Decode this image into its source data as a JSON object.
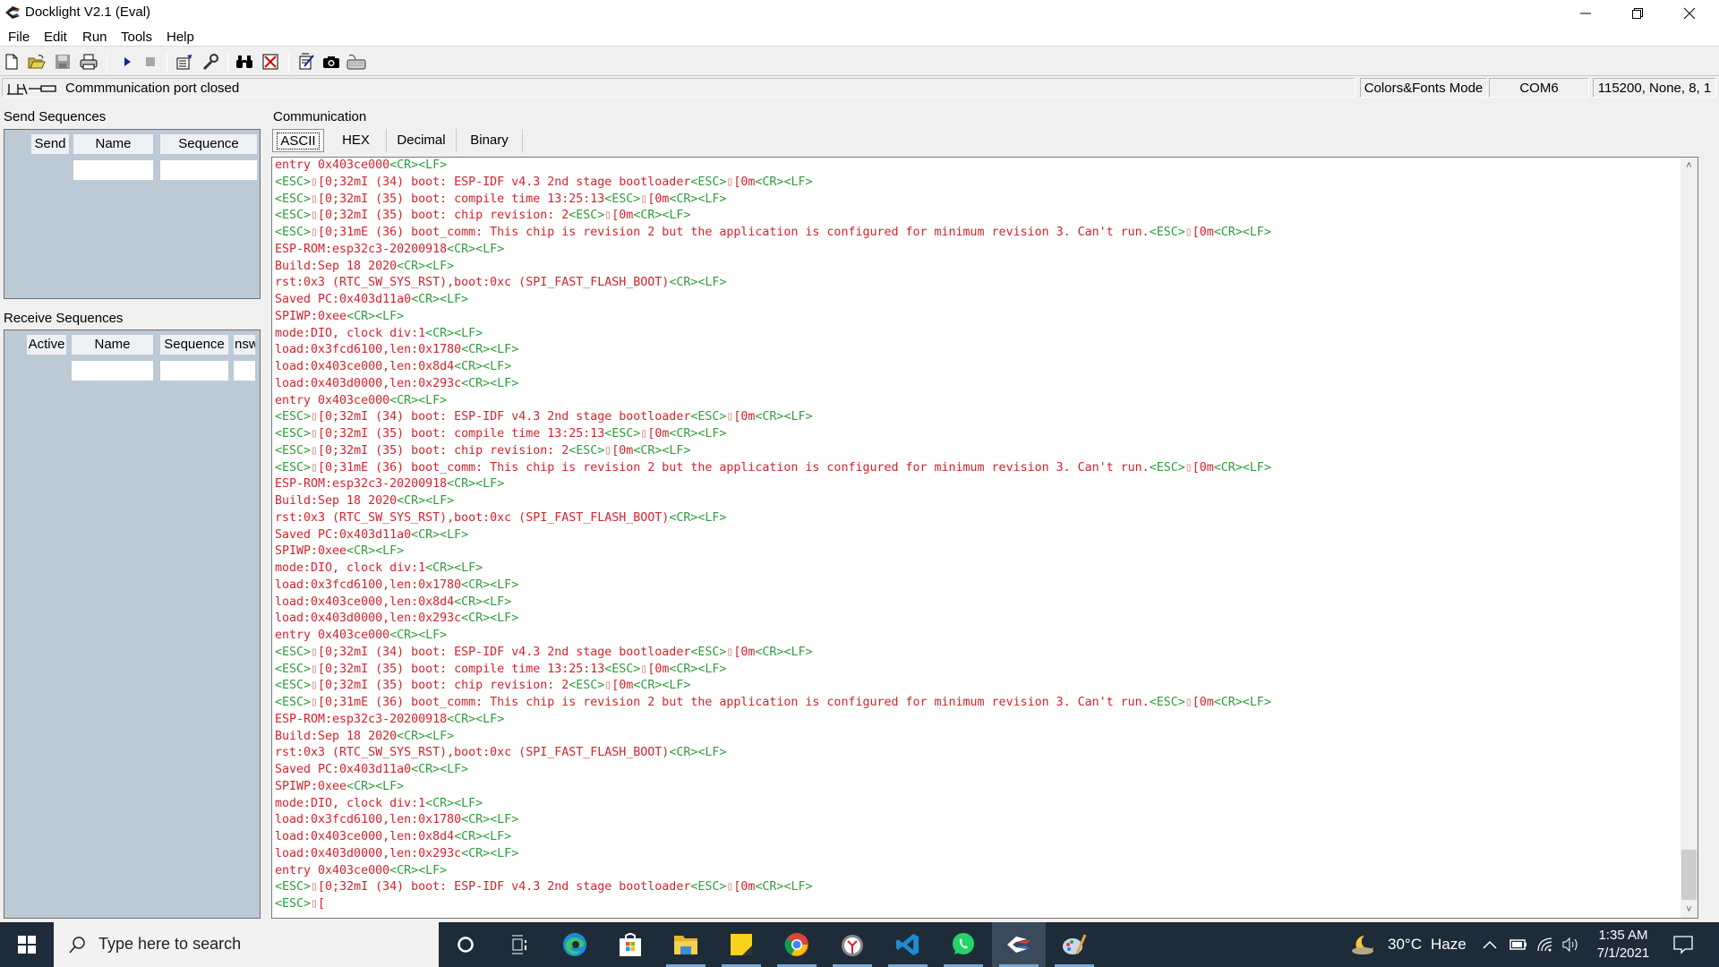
{
  "window": {
    "title": "Docklight V2.1 (Eval)",
    "controls": {
      "minimize": "—",
      "restore": "❐",
      "close": "✕"
    }
  },
  "menu": [
    "File",
    "Edit",
    "Run",
    "Tools",
    "Help"
  ],
  "toolbar": {
    "buttons": [
      "new-icon",
      "open-icon",
      "save-icon",
      "print-icon",
      "run-icon",
      "stop-icon",
      "project-settings-icon",
      "options-icon",
      "find-icon",
      "clear-icon",
      "edit-script-icon",
      "snapshot-icon",
      "keyboard-icon"
    ]
  },
  "status": {
    "message": "Commmunication port closed",
    "mode": "Colors&Fonts Mode",
    "port": "COM6",
    "settings": "115200, None, 8, 1"
  },
  "send_sequences": {
    "label": "Send Sequences",
    "columns": [
      "Send",
      "Name",
      "Sequence"
    ]
  },
  "receive_sequences": {
    "label": "Receive Sequences",
    "columns": [
      "Active",
      "Name",
      "Sequence",
      "nsw"
    ]
  },
  "communication": {
    "label": "Communication",
    "tabs": [
      "ASCII",
      "HEX",
      "Decimal",
      "Binary"
    ],
    "active_tab": "ASCII",
    "colors": {
      "data": "#d6222a",
      "control": "#2f9b3c"
    },
    "lines": [
      "entry 0x403ce000<CR><LF>",
      "<ESC>▯[0;32mI (34) boot: ESP-IDF v4.3 2nd stage bootloader<ESC>▯[0m<CR><LF>",
      "<ESC>▯[0;32mI (35) boot: compile time 13:25:13<ESC>▯[0m<CR><LF>",
      "<ESC>▯[0;32mI (35) boot: chip revision: 2<ESC>▯[0m<CR><LF>",
      "<ESC>▯[0;31mE (36) boot_comm: This chip is revision 2 but the application is configured for minimum revision 3. Can't run.<ESC>▯[0m<CR><LF>",
      "ESP-ROM:esp32c3-20200918<CR><LF>",
      "Build:Sep 18 2020<CR><LF>",
      "rst:0x3 (RTC_SW_SYS_RST),boot:0xc (SPI_FAST_FLASH_BOOT)<CR><LF>",
      "Saved PC:0x403d11a0<CR><LF>",
      "SPIWP:0xee<CR><LF>",
      "mode:DIO, clock div:1<CR><LF>",
      "load:0x3fcd6100,len:0x1780<CR><LF>",
      "load:0x403ce000,len:0x8d4<CR><LF>",
      "load:0x403d0000,len:0x293c<CR><LF>",
      "entry 0x403ce000<CR><LF>",
      "<ESC>▯[0;32mI (34) boot: ESP-IDF v4.3 2nd stage bootloader<ESC>▯[0m<CR><LF>",
      "<ESC>▯[0;32mI (35) boot: compile time 13:25:13<ESC>▯[0m<CR><LF>",
      "<ESC>▯[0;32mI (35) boot: chip revision: 2<ESC>▯[0m<CR><LF>",
      "<ESC>▯[0;31mE (36) boot_comm: This chip is revision 2 but the application is configured for minimum revision 3. Can't run.<ESC>▯[0m<CR><LF>",
      "ESP-ROM:esp32c3-20200918<CR><LF>",
      "Build:Sep 18 2020<CR><LF>",
      "rst:0x3 (RTC_SW_SYS_RST),boot:0xc (SPI_FAST_FLASH_BOOT)<CR><LF>",
      "Saved PC:0x403d11a0<CR><LF>",
      "SPIWP:0xee<CR><LF>",
      "mode:DIO, clock div:1<CR><LF>",
      "load:0x3fcd6100,len:0x1780<CR><LF>",
      "load:0x403ce000,len:0x8d4<CR><LF>",
      "load:0x403d0000,len:0x293c<CR><LF>",
      "entry 0x403ce000<CR><LF>",
      "<ESC>▯[0;32mI (34) boot: ESP-IDF v4.3 2nd stage bootloader<ESC>▯[0m<CR><LF>",
      "<ESC>▯[0;32mI (35) boot: compile time 13:25:13<ESC>▯[0m<CR><LF>",
      "<ESC>▯[0;32mI (35) boot: chip revision: 2<ESC>▯[0m<CR><LF>",
      "<ESC>▯[0;31mE (36) boot_comm: This chip is revision 2 but the application is configured for minimum revision 3. Can't run.<ESC>▯[0m<CR><LF>",
      "ESP-ROM:esp32c3-20200918<CR><LF>",
      "Build:Sep 18 2020<CR><LF>",
      "rst:0x3 (RTC_SW_SYS_RST),boot:0xc (SPI_FAST_FLASH_BOOT)<CR><LF>",
      "Saved PC:0x403d11a0<CR><LF>",
      "SPIWP:0xee<CR><LF>",
      "mode:DIO, clock div:1<CR><LF>",
      "load:0x3fcd6100,len:0x1780<CR><LF>",
      "load:0x403ce000,len:0x8d4<CR><LF>",
      "load:0x403d0000,len:0x293c<CR><LF>",
      "entry 0x403ce000<CR><LF>",
      "<ESC>▯[0;32mI (34) boot: ESP-IDF v4.3 2nd stage bootloader<ESC>▯[0m<CR><LF>",
      "<ESC>▯["
    ],
    "scroll_position": 0.97
  },
  "taskbar": {
    "search_placeholder": "Type here to search",
    "apps": [
      "cortana-icon",
      "task-view-icon",
      "edge-icon",
      "store-icon",
      "file-explorer-icon",
      "sticky-notes-icon",
      "chrome-icon",
      "clock-app-icon",
      "vscode-icon",
      "whatsapp-icon",
      "docklight-icon",
      "paint-icon"
    ],
    "weather": {
      "temp": "30°C",
      "condition": "Haze"
    },
    "time": "1:35 AM",
    "date": "7/1/2021"
  }
}
